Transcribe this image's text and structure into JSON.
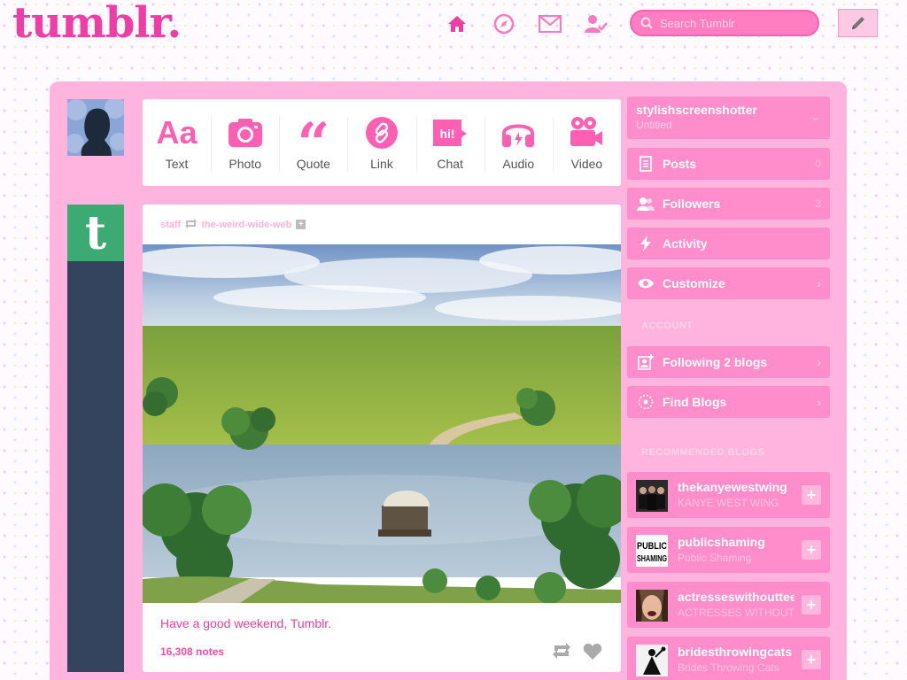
{
  "brand": {
    "logo": "tumblr.",
    "accent": "#ee3ea6",
    "panel": "#ffb3df",
    "sidebar_item": "#ff8ccb"
  },
  "header": {
    "nav_icons": [
      "home-icon",
      "explore-icon",
      "inbox-icon",
      "activity-icon"
    ],
    "search": {
      "placeholder": "Search Tumblr"
    },
    "compose_icon": "pencil-icon"
  },
  "post_types": [
    {
      "label": "Text",
      "icon": "text-icon"
    },
    {
      "label": "Photo",
      "icon": "camera-icon"
    },
    {
      "label": "Quote",
      "icon": "quote-icon"
    },
    {
      "label": "Link",
      "icon": "link-icon"
    },
    {
      "label": "Chat",
      "icon": "chat-icon",
      "glyph": "hi!"
    },
    {
      "label": "Audio",
      "icon": "headphones-icon"
    },
    {
      "label": "Video",
      "icon": "video-camera-icon"
    }
  ],
  "post": {
    "reblogger": "staff",
    "source": "the-weird-wide-web",
    "follow_glyph": "+",
    "caption": "Have a good weekend, Tumblr.",
    "notes": "16,308 notes"
  },
  "sidebar": {
    "blog": {
      "name": "stylishscreenshotter",
      "subtitle": "Untitled",
      "chevron": "⌄"
    },
    "items": [
      {
        "label": "Posts",
        "count": "0",
        "icon": "document-icon"
      },
      {
        "label": "Followers",
        "count": "3",
        "icon": "followers-icon"
      },
      {
        "label": "Activity",
        "count": "",
        "icon": "lightning-icon"
      },
      {
        "label": "Customize",
        "count": "",
        "icon": "eye-icon",
        "chevron": "›"
      }
    ],
    "account_heading": "ACCOUNT",
    "account_items": [
      {
        "label": "Following 2 blogs",
        "icon": "following-icon",
        "chevron": "›"
      },
      {
        "label": "Find Blogs",
        "icon": "compass-icon",
        "chevron": "›"
      }
    ],
    "recommended_heading": "RECOMMENDED BLOGS",
    "recommended": [
      {
        "name": "thekanyewestwing",
        "subtitle": "KANYE WEST WING"
      },
      {
        "name": "publicshaming",
        "subtitle": "Public Shaming",
        "thumb_text": "PUBLIC SHAMING"
      },
      {
        "name": "actresseswithoutteeth",
        "subtitle": "ACTRESSES WITHOUT TEETH"
      },
      {
        "name": "bridesthrowingcats",
        "subtitle": "Brides Throwing Cats"
      }
    ],
    "follow_glyph": "+"
  }
}
